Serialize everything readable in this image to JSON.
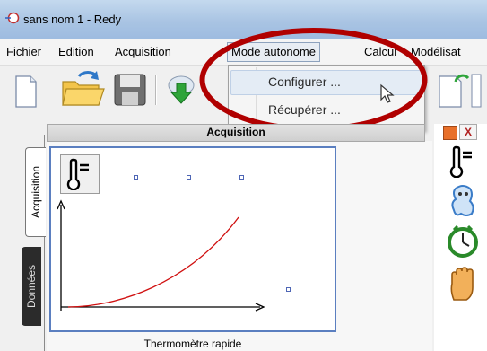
{
  "window": {
    "title": "sans nom 1 - Redy"
  },
  "menu": [
    "Fichier",
    "Edition",
    "Acquisition",
    "Mode autonome",
    "Calcul",
    "Modélisat"
  ],
  "dropdown": {
    "items": [
      "Configurer ...",
      "Récupérer ..."
    ]
  },
  "tabs": {
    "acquisition": "Acquisition",
    "donnees": "Données"
  },
  "panel": {
    "title": "Acquisition"
  },
  "sensor": {
    "caption": "Thermomètre rapide"
  },
  "right_panel": {
    "close_label": "X"
  },
  "colors": {
    "highlight_ellipse": "#b00000",
    "curve": "#d01010",
    "frame": "#5b7fc0"
  },
  "icons": [
    "new-document-icon",
    "open-folder-icon",
    "save-icon",
    "download-icon",
    "refresh-icon",
    "thermometer-icon",
    "ghost-icon",
    "stopwatch-icon",
    "hand-icon",
    "cursor-icon"
  ]
}
